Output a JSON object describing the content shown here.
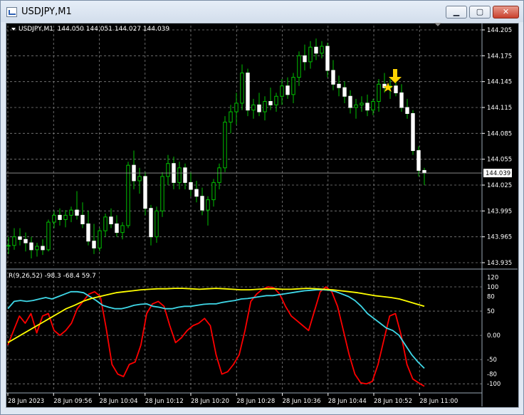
{
  "window": {
    "title": "USDJPY,M1",
    "min_glyph": "▁",
    "max_glyph": "▢",
    "close_glyph": "✕"
  },
  "price_panel": {
    "symbol_line": "USDJPY,M1  144.050 144.051 144.027 144.039",
    "current_price_label": "144.039",
    "y_ticks": [
      "144.205",
      "144.175",
      "144.145",
      "144.115",
      "144.085",
      "144.055",
      "144.025",
      "143.995",
      "143.965",
      "143.935"
    ]
  },
  "indicator_panel": {
    "header": "R(9,26,52) -98.3 -68.4 59.7",
    "y_ticks": [
      "120",
      "100",
      "80",
      "50",
      "0.00",
      "-50",
      "-80",
      "-100"
    ]
  },
  "time_axis": [
    "28 Jun 2023",
    "28 Jun 09:56",
    "28 Jun 10:04",
    "28 Jun 10:12",
    "28 Jun 10:20",
    "28 Jun 10:28",
    "28 Jun 10:36",
    "28 Jun 10:44",
    "28 Jun 10:52",
    "28 Jun 11:00"
  ],
  "colors": {
    "background": "#000000",
    "grid": "#808080",
    "bull": "#ffffff",
    "bear": "#ffffff",
    "wick": "#00c000",
    "red_line": "#ff0000",
    "cyan_line": "#3fd8e8",
    "yellow_line": "#ffff00",
    "arrow": "#ffd400"
  },
  "chart_data": {
    "type": "candlestick",
    "price_range": [
      143.935,
      144.205
    ],
    "candles": [
      [
        143.955,
        143.965,
        143.945,
        143.955
      ],
      [
        143.955,
        143.975,
        143.95,
        143.965
      ],
      [
        143.965,
        143.975,
        143.955,
        143.962
      ],
      [
        143.962,
        143.97,
        143.948,
        143.958
      ],
      [
        143.958,
        143.965,
        143.94,
        143.95
      ],
      [
        143.95,
        143.958,
        143.942,
        143.954
      ],
      [
        143.954,
        143.962,
        143.944,
        143.95
      ],
      [
        143.95,
        143.985,
        143.948,
        143.982
      ],
      [
        143.982,
        143.995,
        143.975,
        143.99
      ],
      [
        143.99,
        143.998,
        143.978,
        143.985
      ],
      [
        143.985,
        143.996,
        143.976,
        143.99
      ],
      [
        143.99,
        144.0,
        143.982,
        143.996
      ],
      [
        143.996,
        144.018,
        143.985,
        143.99
      ],
      [
        143.99,
        144.005,
        143.975,
        143.98
      ],
      [
        143.98,
        143.995,
        143.955,
        143.96
      ],
      [
        143.96,
        143.98,
        143.945,
        143.952
      ],
      [
        143.952,
        143.975,
        143.948,
        143.972
      ],
      [
        143.972,
        143.992,
        143.965,
        143.988
      ],
      [
        143.988,
        143.998,
        143.975,
        143.98
      ],
      [
        143.98,
        143.99,
        143.965,
        143.97
      ],
      [
        143.97,
        143.982,
        143.962,
        143.978
      ],
      [
        143.978,
        144.052,
        143.975,
        144.048
      ],
      [
        144.048,
        144.065,
        144.02,
        144.03
      ],
      [
        144.03,
        144.045,
        144.015,
        144.035
      ],
      [
        144.035,
        144.04,
        143.99,
        143.998
      ],
      [
        143.998,
        144.002,
        143.955,
        143.965
      ],
      [
        143.965,
        144.0,
        143.958,
        143.995
      ],
      [
        143.995,
        144.04,
        143.988,
        144.035
      ],
      [
        144.035,
        144.06,
        144.025,
        144.05
      ],
      [
        144.05,
        144.058,
        144.02,
        144.028
      ],
      [
        144.028,
        144.052,
        144.02,
        144.045
      ],
      [
        144.045,
        144.05,
        144.02,
        144.028
      ],
      [
        144.028,
        144.04,
        144.012,
        144.02
      ],
      [
        144.02,
        144.03,
        144.005,
        144.012
      ],
      [
        144.012,
        144.022,
        143.99,
        143.996
      ],
      [
        143.996,
        144.012,
        143.978,
        144.008
      ],
      [
        144.008,
        144.032,
        144.0,
        144.028
      ],
      [
        144.028,
        144.05,
        144.02,
        144.045
      ],
      [
        144.045,
        144.105,
        144.04,
        144.098
      ],
      [
        144.098,
        144.118,
        144.085,
        144.11
      ],
      [
        144.11,
        144.132,
        144.095,
        144.12
      ],
      [
        144.12,
        144.165,
        144.112,
        144.155
      ],
      [
        144.155,
        144.16,
        144.105,
        144.112
      ],
      [
        144.112,
        144.125,
        144.102,
        144.118
      ],
      [
        144.118,
        144.132,
        144.105,
        144.11
      ],
      [
        144.11,
        144.128,
        144.1,
        144.122
      ],
      [
        144.122,
        144.138,
        144.112,
        144.118
      ],
      [
        144.118,
        144.132,
        144.11,
        144.128
      ],
      [
        144.128,
        144.148,
        144.118,
        144.14
      ],
      [
        144.14,
        144.15,
        144.125,
        144.13
      ],
      [
        144.13,
        144.155,
        144.12,
        144.15
      ],
      [
        144.15,
        144.18,
        144.14,
        144.175
      ],
      [
        144.175,
        144.188,
        144.158,
        144.168
      ],
      [
        144.168,
        144.192,
        144.16,
        144.185
      ],
      [
        144.185,
        144.195,
        144.17,
        144.178
      ],
      [
        144.178,
        144.192,
        144.172,
        144.186
      ],
      [
        144.186,
        144.19,
        144.15,
        144.158
      ],
      [
        144.158,
        144.17,
        144.135,
        144.142
      ],
      [
        144.142,
        144.152,
        144.128,
        144.138
      ],
      [
        144.138,
        144.145,
        144.12,
        144.128
      ],
      [
        144.128,
        144.135,
        144.108,
        144.115
      ],
      [
        144.115,
        144.125,
        144.102,
        144.118
      ],
      [
        144.118,
        144.128,
        144.11,
        144.12
      ],
      [
        144.12,
        144.13,
        144.105,
        144.112
      ],
      [
        144.112,
        144.125,
        144.106,
        144.122
      ],
      [
        144.122,
        144.148,
        144.11,
        144.142
      ],
      [
        144.142,
        144.155,
        144.132,
        144.138
      ],
      [
        144.138,
        144.148,
        144.125,
        144.14
      ],
      [
        144.14,
        144.152,
        144.128,
        144.132
      ],
      [
        144.132,
        144.142,
        144.11,
        144.115
      ],
      [
        144.115,
        144.125,
        144.102,
        144.108
      ],
      [
        144.108,
        144.112,
        144.06,
        144.065
      ],
      [
        144.065,
        144.07,
        144.035,
        144.042
      ],
      [
        144.042,
        144.045,
        144.025,
        144.039
      ]
    ],
    "indicator_range": [
      -110,
      125
    ],
    "series": [
      {
        "name": "-98.3",
        "color": "#ff0000",
        "values": [
          -20,
          10,
          40,
          25,
          45,
          5,
          40,
          45,
          10,
          0,
          10,
          25,
          55,
          70,
          85,
          90,
          80,
          15,
          -60,
          -80,
          -85,
          -60,
          -55,
          -20,
          45,
          65,
          70,
          60,
          20,
          -15,
          -5,
          10,
          20,
          25,
          35,
          20,
          -40,
          -80,
          -75,
          -60,
          -40,
          10,
          70,
          85,
          95,
          100,
          98,
          85,
          60,
          40,
          30,
          20,
          10,
          50,
          90,
          100,
          90,
          60,
          10,
          -40,
          -80,
          -98,
          -100,
          -95,
          -60,
          -10,
          40,
          45,
          0,
          -60,
          -90,
          -98,
          -105
        ]
      },
      {
        "name": "-68.4",
        "color": "#3fd8e8",
        "values": [
          55,
          70,
          72,
          70,
          72,
          75,
          78,
          75,
          80,
          85,
          90,
          90,
          88,
          80,
          72,
          62,
          58,
          55,
          55,
          58,
          62,
          64,
          65,
          60,
          58,
          55,
          55,
          58,
          60,
          60,
          62,
          64,
          65,
          65,
          68,
          70,
          72,
          75,
          76,
          78,
          80,
          82,
          82,
          84,
          86,
          88,
          90,
          92,
          93,
          94,
          94,
          93,
          90,
          85,
          80,
          72,
          60,
          45,
          35,
          25,
          15,
          10,
          0,
          -20,
          -40,
          -55,
          -68
        ]
      },
      {
        "name": "59.7",
        "color": "#ffff00",
        "values": [
          -15,
          -5,
          5,
          15,
          25,
          35,
          45,
          55,
          62,
          70,
          76,
          80,
          84,
          88,
          90,
          92,
          94,
          95,
          96,
          96,
          97,
          97,
          96,
          95,
          96,
          97,
          96,
          95,
          94,
          94,
          95,
          96,
          96,
          95,
          95,
          96,
          97,
          96,
          95,
          94,
          92,
          90,
          88,
          85,
          82,
          80,
          78,
          75,
          70,
          65,
          60
        ]
      }
    ]
  }
}
